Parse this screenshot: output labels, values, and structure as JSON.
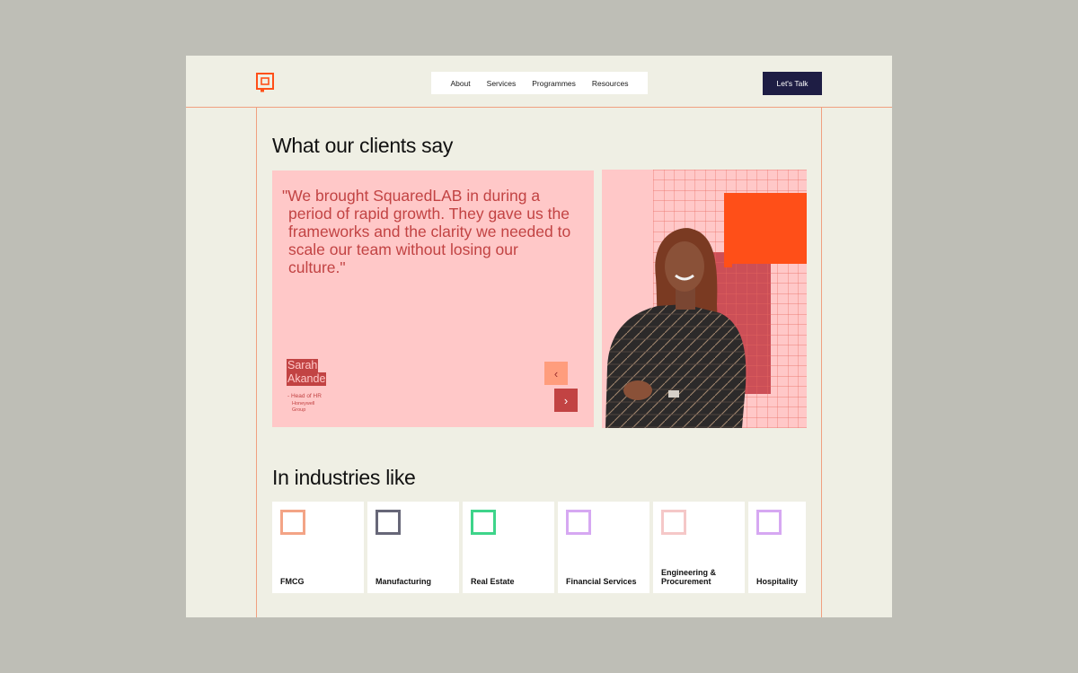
{
  "header": {
    "logo_icon": "squaredlab-logo-icon",
    "nav": [
      {
        "label": "About"
      },
      {
        "label": "Services"
      },
      {
        "label": "Programmes"
      },
      {
        "label": "Resources"
      }
    ],
    "cta_label": "Let's Talk"
  },
  "testimonials": {
    "heading": "What our clients say",
    "quote": "\"We brought SquaredLAB in during a period of rapid growth. They gave us the frameworks and the clarity we needed to scale our team without losing our culture.\"",
    "name_first": "Sarah",
    "name_last": "Akande",
    "role": "- Head of HR",
    "company": "Honeywell Group",
    "prev_icon": "‹",
    "next_icon": "›"
  },
  "industries": {
    "heading": "In industries like",
    "items": [
      {
        "label": "FMCG",
        "color": "#f3a486"
      },
      {
        "label": "Manufacturing",
        "color": "#676778"
      },
      {
        "label": "Real Estate",
        "color": "#3ed48a"
      },
      {
        "label": "Financial Services",
        "color": "#d6a8f2"
      },
      {
        "label": "Engineering & Procurement",
        "color": "#f5c8c8"
      },
      {
        "label": "Hospitality",
        "color": "#d6a8f2"
      }
    ]
  },
  "colors": {
    "accent": "#ff4f18",
    "rose": "#c24343",
    "pink": "#ffc8c8",
    "navy": "#1e1d44"
  }
}
